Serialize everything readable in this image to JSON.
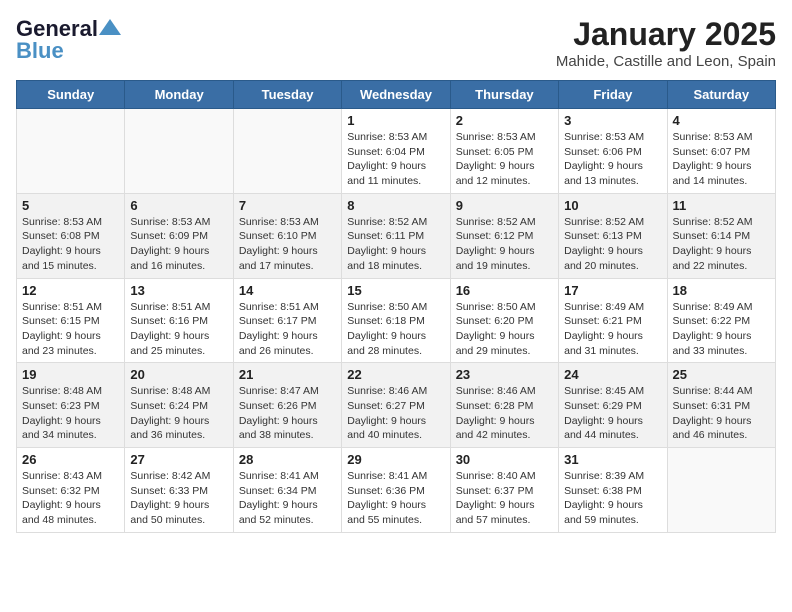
{
  "logo": {
    "line1": "General",
    "line2": "Blue"
  },
  "title": "January 2025",
  "subtitle": "Mahide, Castille and Leon, Spain",
  "days_of_week": [
    "Sunday",
    "Monday",
    "Tuesday",
    "Wednesday",
    "Thursday",
    "Friday",
    "Saturday"
  ],
  "weeks": [
    [
      {
        "day": "",
        "text": ""
      },
      {
        "day": "",
        "text": ""
      },
      {
        "day": "",
        "text": ""
      },
      {
        "day": "1",
        "text": "Sunrise: 8:53 AM\nSunset: 6:04 PM\nDaylight: 9 hours and 11 minutes."
      },
      {
        "day": "2",
        "text": "Sunrise: 8:53 AM\nSunset: 6:05 PM\nDaylight: 9 hours and 12 minutes."
      },
      {
        "day": "3",
        "text": "Sunrise: 8:53 AM\nSunset: 6:06 PM\nDaylight: 9 hours and 13 minutes."
      },
      {
        "day": "4",
        "text": "Sunrise: 8:53 AM\nSunset: 6:07 PM\nDaylight: 9 hours and 14 minutes."
      }
    ],
    [
      {
        "day": "5",
        "text": "Sunrise: 8:53 AM\nSunset: 6:08 PM\nDaylight: 9 hours and 15 minutes."
      },
      {
        "day": "6",
        "text": "Sunrise: 8:53 AM\nSunset: 6:09 PM\nDaylight: 9 hours and 16 minutes."
      },
      {
        "day": "7",
        "text": "Sunrise: 8:53 AM\nSunset: 6:10 PM\nDaylight: 9 hours and 17 minutes."
      },
      {
        "day": "8",
        "text": "Sunrise: 8:52 AM\nSunset: 6:11 PM\nDaylight: 9 hours and 18 minutes."
      },
      {
        "day": "9",
        "text": "Sunrise: 8:52 AM\nSunset: 6:12 PM\nDaylight: 9 hours and 19 minutes."
      },
      {
        "day": "10",
        "text": "Sunrise: 8:52 AM\nSunset: 6:13 PM\nDaylight: 9 hours and 20 minutes."
      },
      {
        "day": "11",
        "text": "Sunrise: 8:52 AM\nSunset: 6:14 PM\nDaylight: 9 hours and 22 minutes."
      }
    ],
    [
      {
        "day": "12",
        "text": "Sunrise: 8:51 AM\nSunset: 6:15 PM\nDaylight: 9 hours and 23 minutes."
      },
      {
        "day": "13",
        "text": "Sunrise: 8:51 AM\nSunset: 6:16 PM\nDaylight: 9 hours and 25 minutes."
      },
      {
        "day": "14",
        "text": "Sunrise: 8:51 AM\nSunset: 6:17 PM\nDaylight: 9 hours and 26 minutes."
      },
      {
        "day": "15",
        "text": "Sunrise: 8:50 AM\nSunset: 6:18 PM\nDaylight: 9 hours and 28 minutes."
      },
      {
        "day": "16",
        "text": "Sunrise: 8:50 AM\nSunset: 6:20 PM\nDaylight: 9 hours and 29 minutes."
      },
      {
        "day": "17",
        "text": "Sunrise: 8:49 AM\nSunset: 6:21 PM\nDaylight: 9 hours and 31 minutes."
      },
      {
        "day": "18",
        "text": "Sunrise: 8:49 AM\nSunset: 6:22 PM\nDaylight: 9 hours and 33 minutes."
      }
    ],
    [
      {
        "day": "19",
        "text": "Sunrise: 8:48 AM\nSunset: 6:23 PM\nDaylight: 9 hours and 34 minutes."
      },
      {
        "day": "20",
        "text": "Sunrise: 8:48 AM\nSunset: 6:24 PM\nDaylight: 9 hours and 36 minutes."
      },
      {
        "day": "21",
        "text": "Sunrise: 8:47 AM\nSunset: 6:26 PM\nDaylight: 9 hours and 38 minutes."
      },
      {
        "day": "22",
        "text": "Sunrise: 8:46 AM\nSunset: 6:27 PM\nDaylight: 9 hours and 40 minutes."
      },
      {
        "day": "23",
        "text": "Sunrise: 8:46 AM\nSunset: 6:28 PM\nDaylight: 9 hours and 42 minutes."
      },
      {
        "day": "24",
        "text": "Sunrise: 8:45 AM\nSunset: 6:29 PM\nDaylight: 9 hours and 44 minutes."
      },
      {
        "day": "25",
        "text": "Sunrise: 8:44 AM\nSunset: 6:31 PM\nDaylight: 9 hours and 46 minutes."
      }
    ],
    [
      {
        "day": "26",
        "text": "Sunrise: 8:43 AM\nSunset: 6:32 PM\nDaylight: 9 hours and 48 minutes."
      },
      {
        "day": "27",
        "text": "Sunrise: 8:42 AM\nSunset: 6:33 PM\nDaylight: 9 hours and 50 minutes."
      },
      {
        "day": "28",
        "text": "Sunrise: 8:41 AM\nSunset: 6:34 PM\nDaylight: 9 hours and 52 minutes."
      },
      {
        "day": "29",
        "text": "Sunrise: 8:41 AM\nSunset: 6:36 PM\nDaylight: 9 hours and 55 minutes."
      },
      {
        "day": "30",
        "text": "Sunrise: 8:40 AM\nSunset: 6:37 PM\nDaylight: 9 hours and 57 minutes."
      },
      {
        "day": "31",
        "text": "Sunrise: 8:39 AM\nSunset: 6:38 PM\nDaylight: 9 hours and 59 minutes."
      },
      {
        "day": "",
        "text": ""
      }
    ]
  ],
  "row_shaded": [
    false,
    true,
    false,
    true,
    false
  ]
}
